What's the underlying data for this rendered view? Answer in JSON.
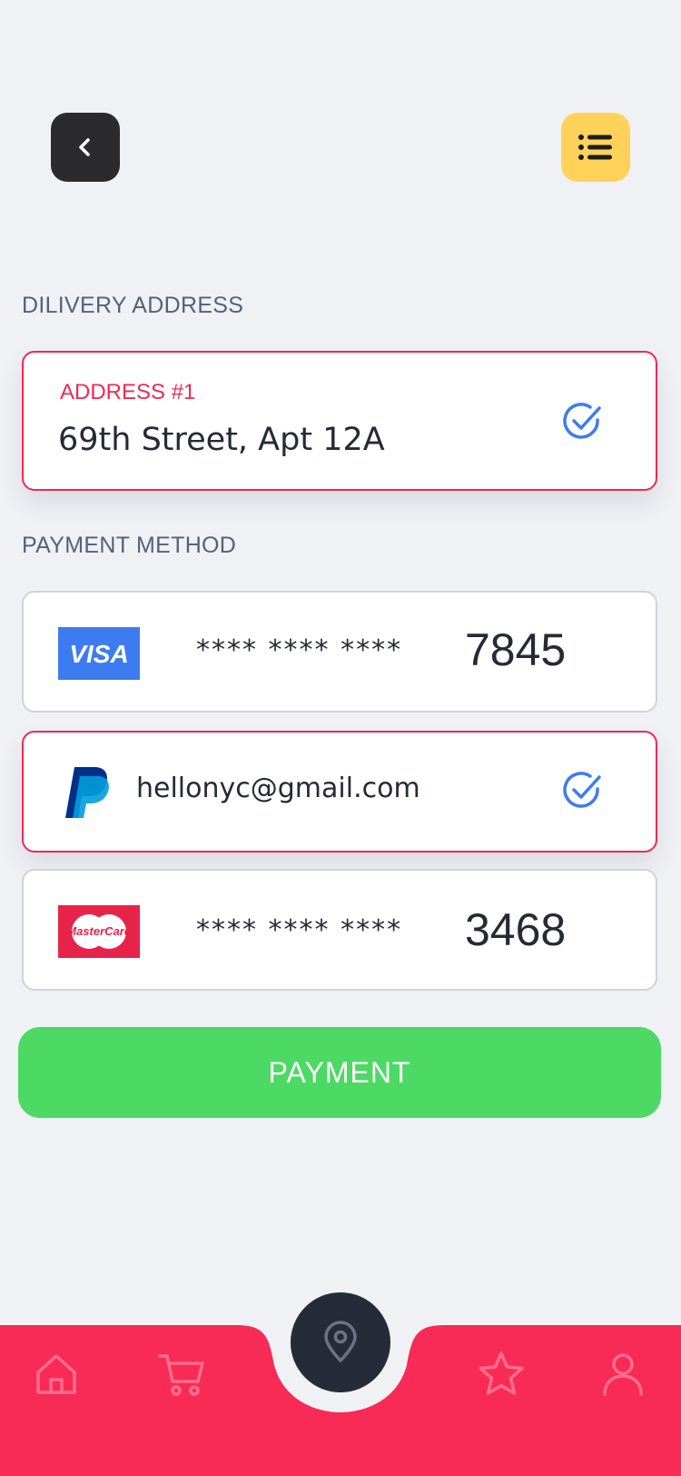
{
  "header": {
    "back_icon": "chevron-left-icon",
    "menu_icon": "list-icon"
  },
  "delivery": {
    "section_label": "DILIVERY ADDRESS",
    "address_tag": "ADDRESS #1",
    "address_line": "69th Street, Apt 12A",
    "selected": true
  },
  "payment": {
    "section_label": "PAYMENT METHOD",
    "methods": [
      {
        "brand": "VISA",
        "masked": "**** **** ****",
        "last4": "7845",
        "selected": false
      },
      {
        "brand": "PayPal",
        "email": "hellonyc@gmail.com",
        "selected": true
      },
      {
        "brand": "MasterCard",
        "masked": "**** **** ****",
        "last4": "3468",
        "selected": false
      }
    ],
    "button_label": "PAYMENT"
  },
  "colors": {
    "accent_red": "#ee2a54",
    "nav_bg": "#f72b55",
    "pay_green": "#4cd964",
    "menu_yellow": "#ffd35a",
    "check_blue": "#3d7cf0"
  },
  "nav": {
    "items": [
      "home-icon",
      "cart-icon",
      "location-pin-icon",
      "star-icon",
      "user-icon"
    ]
  }
}
